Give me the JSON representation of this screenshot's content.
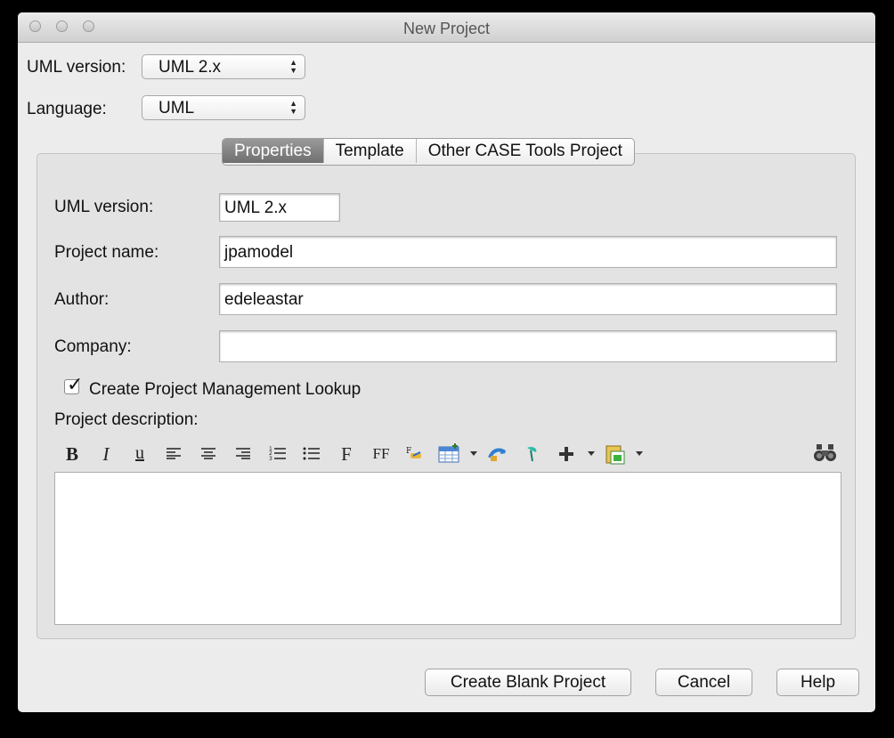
{
  "window": {
    "title": "New Project"
  },
  "top": {
    "uml_version_label": "UML version:",
    "uml_version_value": "UML 2.x",
    "language_label": "Language:",
    "language_value": "UML"
  },
  "tabs": [
    {
      "label": "Properties",
      "active": true
    },
    {
      "label": "Template",
      "active": false
    },
    {
      "label": "Other CASE Tools Project",
      "active": false
    }
  ],
  "form": {
    "uml_version_label": "UML version:",
    "uml_version_value": "UML 2.x",
    "project_name_label": "Project name:",
    "project_name_value": "jpamodel",
    "author_label": "Author:",
    "author_value": "edeleastar",
    "company_label": "Company:",
    "company_value": "",
    "lookup_checkbox_label": "Create Project Management Lookup",
    "lookup_checked": true,
    "description_label": "Project description:",
    "description_value": ""
  },
  "toolbar": {
    "icons": [
      "bold-icon",
      "italic-icon",
      "underline-icon",
      "align-left-icon",
      "align-center-icon",
      "align-right-icon",
      "numbered-list-icon",
      "bulleted-list-icon",
      "font-icon",
      "font-size-icon",
      "text-color-icon",
      "insert-table-icon",
      "insert-link-icon",
      "insert-image-icon",
      "add-icon",
      "paste-icon",
      "find-icon"
    ],
    "bold": "B",
    "italic": "I",
    "underline": "u",
    "font": "F",
    "font_size": "FF"
  },
  "buttons": {
    "create_blank": "Create Blank Project",
    "cancel": "Cancel",
    "help": "Help"
  }
}
